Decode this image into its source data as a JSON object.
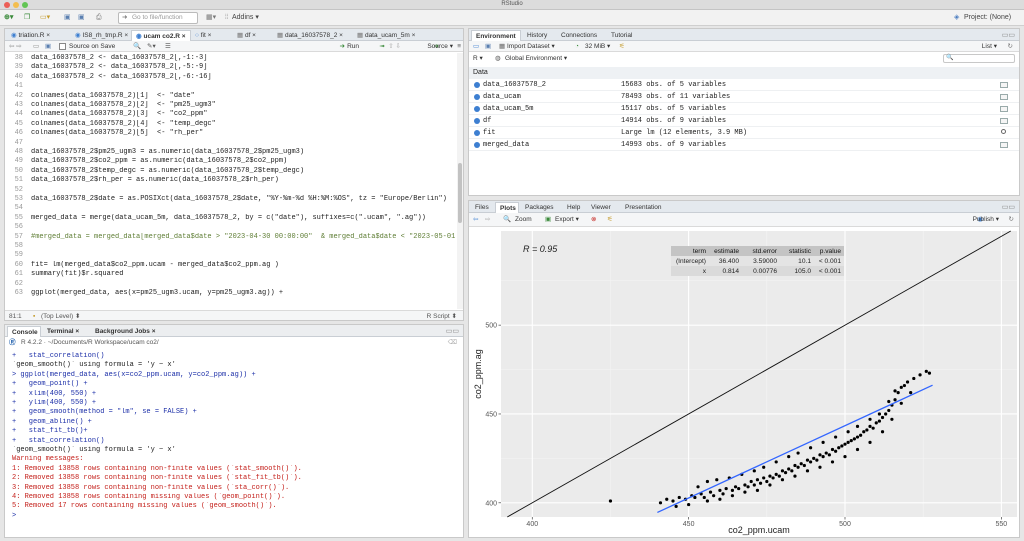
{
  "window": {
    "title": "RStudio",
    "project": "Project: (None)"
  },
  "toolbar": {
    "go_to_function": "Go to file/function",
    "addins": "Addins"
  },
  "editor": {
    "tabs": [
      "triation.R",
      "IS8_rh_tmp.R",
      "ucam co2.R",
      "fit",
      "df",
      "data_16037578_2",
      "data_ucam_5m"
    ],
    "toolbar": {
      "source_on_save": "Source on Save",
      "run": "Run",
      "source": "Source"
    },
    "lines": [
      {
        "n": "38",
        "t": "data_16037578_2 <- data_16037578_2[,-1:-3]",
        "c": ""
      },
      {
        "n": "39",
        "t": "data_16037578_2 <- data_16037578_2[,-5:-9]",
        "c": ""
      },
      {
        "n": "40",
        "t": "data_16037578_2 <- data_16037578_2[,-6:-16]",
        "c": ""
      },
      {
        "n": "41",
        "t": "",
        "c": ""
      },
      {
        "n": "42",
        "t": "colnames(data_16037578_2)[1]  <- \"date\"",
        "c": ""
      },
      {
        "n": "43",
        "t": "colnames(data_16037578_2)[2]  <- \"pm25_ugm3\"",
        "c": ""
      },
      {
        "n": "44",
        "t": "colnames(data_16037578_2)[3]  <- \"co2_ppm\"",
        "c": ""
      },
      {
        "n": "45",
        "t": "colnames(data_16037578_2)[4]  <- \"temp_degc\"",
        "c": ""
      },
      {
        "n": "46",
        "t": "colnames(data_16037578_2)[5]  <- \"rh_per\"",
        "c": ""
      },
      {
        "n": "47",
        "t": "",
        "c": ""
      },
      {
        "n": "48",
        "t": "data_16037578_2$pm25_ugm3 = as.numeric(data_16037578_2$pm25_ugm3)",
        "c": ""
      },
      {
        "n": "49",
        "t": "data_16037578_2$co2_ppm = as.numeric(data_16037578_2$co2_ppm)",
        "c": ""
      },
      {
        "n": "50",
        "t": "data_16037578_2$temp_degc = as.numeric(data_16037578_2$temp_degc)",
        "c": ""
      },
      {
        "n": "51",
        "t": "data_16037578_2$rh_per = as.numeric(data_16037578_2$rh_per)",
        "c": ""
      },
      {
        "n": "52",
        "t": "",
        "c": ""
      },
      {
        "n": "53",
        "t": "data_16037578_2$date = as.POSIXct(data_16037578_2$date, \"%Y-%m-%d %H:%M:%OS\", tz = \"Europe/Berlin\")",
        "c": ""
      },
      {
        "n": "54",
        "t": "",
        "c": ""
      },
      {
        "n": "55",
        "t": "merged_data = merge(data_ucam_5m, data_16037578_2, by = c(\"date\"), suffixes=c(\".ucam\", \".ag\"))",
        "c": ""
      },
      {
        "n": "56",
        "t": "",
        "c": ""
      },
      {
        "n": "57",
        "t": "#merged_data = merged_data[merged_data$date > \"2023-04-30 00:00:00\"  & merged_data$date < \"2023-05-01",
        "c": "cmt"
      },
      {
        "n": "58",
        "t": "",
        "c": ""
      },
      {
        "n": "59",
        "t": "",
        "c": ""
      },
      {
        "n": "60",
        "t": "fit= lm(merged_data$co2_ppm.ucam - merged_data$co2_ppm.ag )",
        "c": ""
      },
      {
        "n": "61",
        "t": "summary(fit)$r.squared",
        "c": ""
      },
      {
        "n": "62",
        "t": "",
        "c": ""
      },
      {
        "n": "63",
        "t": "ggplot(merged_data, aes(x=pm25_ugm3.ucam, y=pm25_ugm3.ag)) +",
        "c": ""
      }
    ],
    "status": {
      "pos": "81:1",
      "scope": "(Top Level)",
      "type": "R Script"
    }
  },
  "console": {
    "tabs": [
      "Console",
      "Terminal",
      "Background Jobs"
    ],
    "path": "R 4.2.2 · ~/Documents/R Workspace/ucam co2/",
    "lines": [
      {
        "t": "+   stat_correlation()",
        "c": "c-in"
      },
      {
        "t": "`geom_smooth()` using formula = 'y ~ x'",
        "c": "c-out"
      },
      {
        "t": "> ggplot(merged_data, aes(x=co2_ppm.ucam, y=co2_ppm.ag)) +",
        "c": "c-in"
      },
      {
        "t": "+   geom_point() +",
        "c": "c-in"
      },
      {
        "t": "+   xlim(400, 550) +",
        "c": "c-in"
      },
      {
        "t": "+   ylim(400, 550) +",
        "c": "c-in"
      },
      {
        "t": "+   geom_smooth(method = \"lm\", se = FALSE) +",
        "c": "c-in"
      },
      {
        "t": "+   geom_abline() +",
        "c": "c-in"
      },
      {
        "t": "+   stat_fit_tb()+",
        "c": "c-in"
      },
      {
        "t": "+   stat_correlation()",
        "c": "c-in"
      },
      {
        "t": "`geom_smooth()` using formula = 'y ~ x'",
        "c": "c-out"
      },
      {
        "t": "Warning messages:",
        "c": "c-warn"
      },
      {
        "t": "1: Removed 13858 rows containing non-finite values (`stat_smooth()`).",
        "c": "c-warn"
      },
      {
        "t": "2: Removed 13858 rows containing non-finite values (`stat_fit_tb()`).",
        "c": "c-warn"
      },
      {
        "t": "3: Removed 13858 rows containing non-finite values (`sta_corr()`).",
        "c": "c-warn"
      },
      {
        "t": "4: Removed 13858 rows containing missing values (`geom_point()`).",
        "c": "c-warn"
      },
      {
        "t": "5: Removed 17 rows containing missing values (`geom_smooth()`).",
        "c": "c-warn"
      },
      {
        "t": ">",
        "c": "c-in"
      }
    ]
  },
  "environment": {
    "tabs": [
      "Environment",
      "History",
      "Connections",
      "Tutorial"
    ],
    "import_dataset": "Import Dataset",
    "memory": "32 MiB",
    "view": "List",
    "lang": "R",
    "scope": "Global Environment",
    "section": "Data",
    "rows": [
      {
        "name": "data_16037578_2",
        "value": "15683 obs. of 5 variables",
        "icon": "grid-icon"
      },
      {
        "name": "data_ucam",
        "value": "78493 obs. of 11 variables",
        "icon": "grid-icon"
      },
      {
        "name": "data_ucam_5m",
        "value": "15117 obs. of 5 variables",
        "icon": "grid-icon"
      },
      {
        "name": "df",
        "value": "14914 obs. of 9 variables",
        "icon": "grid-icon"
      },
      {
        "name": "fit",
        "value": "Large lm (12 elements,  3.9 MB)",
        "icon": "search-icon"
      },
      {
        "name": "merged_data",
        "value": "14993 obs. of 9 variables",
        "icon": "grid-icon"
      }
    ]
  },
  "files": {
    "tabs": [
      "Files",
      "Plots",
      "Packages",
      "Help",
      "Viewer",
      "Presentation"
    ],
    "zoom": "Zoom",
    "export": "Export",
    "publish": "Publish"
  },
  "chart_data": {
    "type": "scatter",
    "xlabel": "co2_ppm.ucam",
    "ylabel": "co2_ppm.ag",
    "xlim": [
      390,
      555
    ],
    "ylim": [
      392,
      553
    ],
    "xticks": [
      400,
      450,
      500,
      550
    ],
    "yticks": [
      400,
      450,
      500
    ],
    "annotation": "R = 0.95",
    "abline": {
      "intercept": 0,
      "slope": 1
    },
    "fit_line": {
      "intercept": 36.4,
      "slope": 0.814,
      "x_range": [
        440,
        528
      ]
    },
    "table": {
      "headers": [
        "term",
        "estimate",
        "std.error",
        "statistic",
        "p.value"
      ],
      "rows": [
        [
          "(Intercept)",
          "36.400",
          "3.59000",
          "10.1",
          "< 0.001"
        ],
        [
          "x",
          "0.814",
          "0.00776",
          "105.0",
          "< 0.001"
        ]
      ]
    },
    "points_note": "dense cloud of points from x ≈ 440 to 528 along the fit line",
    "points": [
      [
        425,
        401
      ],
      [
        441,
        400
      ],
      [
        443,
        402
      ],
      [
        445,
        401
      ],
      [
        447,
        403
      ],
      [
        449,
        402
      ],
      [
        451,
        404
      ],
      [
        452,
        403
      ],
      [
        454,
        405
      ],
      [
        455,
        403
      ],
      [
        457,
        406
      ],
      [
        458,
        404
      ],
      [
        460,
        407
      ],
      [
        461,
        405
      ],
      [
        462,
        408
      ],
      [
        464,
        407
      ],
      [
        465,
        409
      ],
      [
        466,
        408
      ],
      [
        468,
        410
      ],
      [
        469,
        409
      ],
      [
        470,
        412
      ],
      [
        471,
        410
      ],
      [
        472,
        413
      ],
      [
        473,
        411
      ],
      [
        474,
        414
      ],
      [
        475,
        412
      ],
      [
        476,
        415
      ],
      [
        477,
        414
      ],
      [
        478,
        416
      ],
      [
        479,
        415
      ],
      [
        480,
        418
      ],
      [
        481,
        417
      ],
      [
        482,
        419
      ],
      [
        483,
        418
      ],
      [
        484,
        421
      ],
      [
        485,
        420
      ],
      [
        486,
        422
      ],
      [
        487,
        421
      ],
      [
        488,
        424
      ],
      [
        489,
        423
      ],
      [
        490,
        425
      ],
      [
        491,
        424
      ],
      [
        492,
        427
      ],
      [
        493,
        426
      ],
      [
        494,
        428
      ],
      [
        495,
        427
      ],
      [
        496,
        430
      ],
      [
        497,
        429
      ],
      [
        498,
        431
      ],
      [
        499,
        432
      ],
      [
        500,
        433
      ],
      [
        501,
        434
      ],
      [
        502,
        435
      ],
      [
        503,
        436
      ],
      [
        504,
        437
      ],
      [
        505,
        438
      ],
      [
        506,
        440
      ],
      [
        507,
        441
      ],
      [
        508,
        443
      ],
      [
        509,
        442
      ],
      [
        510,
        445
      ],
      [
        511,
        446
      ],
      [
        512,
        448
      ],
      [
        513,
        450
      ],
      [
        514,
        452
      ],
      [
        515,
        455
      ],
      [
        516,
        458
      ],
      [
        517,
        462
      ],
      [
        518,
        465
      ],
      [
        520,
        468
      ],
      [
        522,
        470
      ],
      [
        524,
        472
      ],
      [
        526,
        474
      ],
      [
        527,
        473
      ],
      [
        453,
        409
      ],
      [
        456,
        412
      ],
      [
        459,
        413
      ],
      [
        463,
        414
      ],
      [
        467,
        416
      ],
      [
        471,
        418
      ],
      [
        474,
        420
      ],
      [
        478,
        423
      ],
      [
        482,
        426
      ],
      [
        485,
        428
      ],
      [
        489,
        431
      ],
      [
        493,
        434
      ],
      [
        497,
        437
      ],
      [
        501,
        440
      ],
      [
        504,
        443
      ],
      [
        508,
        447
      ],
      [
        511,
        450
      ],
      [
        514,
        457
      ],
      [
        516,
        463
      ],
      [
        519,
        466
      ],
      [
        446,
        398
      ],
      [
        450,
        399
      ],
      [
        456,
        401
      ],
      [
        460,
        402
      ],
      [
        464,
        404
      ],
      [
        468,
        406
      ],
      [
        472,
        407
      ],
      [
        476,
        410
      ],
      [
        480,
        413
      ],
      [
        484,
        415
      ],
      [
        488,
        418
      ],
      [
        492,
        420
      ],
      [
        496,
        423
      ],
      [
        500,
        426
      ],
      [
        504,
        430
      ],
      [
        508,
        434
      ],
      [
        512,
        440
      ],
      [
        515,
        447
      ],
      [
        518,
        456
      ],
      [
        521,
        462
      ]
    ]
  }
}
